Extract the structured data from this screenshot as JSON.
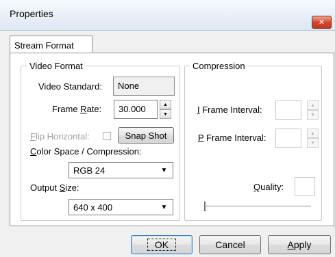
{
  "window": {
    "title": "Properties",
    "close_glyph": "✕"
  },
  "tabs": [
    {
      "label": "Stream Format",
      "selected": true
    }
  ],
  "video_format": {
    "group_label": "Video Format",
    "video_standard_label": "Video Standard:",
    "video_standard_value": "None",
    "frame_rate_label_prefix": "Frame ",
    "frame_rate_label_accel": "R",
    "frame_rate_label_suffix": "ate:",
    "frame_rate_value": "30.000",
    "flip_horizontal_accel": "F",
    "flip_horizontal_rest": "lip Horizontal:",
    "flip_horizontal_checked": false,
    "snap_shot_label": "Snap Shot",
    "color_space_accel": "C",
    "color_space_rest": "olor Space / Compression:",
    "color_space_value": "RGB 24",
    "output_size_prefix": "Output ",
    "output_size_accel": "S",
    "output_size_suffix": "ize:",
    "output_size_value": "640 x 400"
  },
  "compression": {
    "group_label": "Compression",
    "i_frame_accel": "I",
    "i_frame_rest": " Frame Interval:",
    "i_frame_value": "",
    "p_frame_accel": "P",
    "p_frame_rest": " Frame Interval:",
    "p_frame_value": "",
    "quality_accel": "Q",
    "quality_rest": "uality:",
    "quality_value": "",
    "quality_slider_level": 0.0
  },
  "buttons": {
    "ok": "OK",
    "cancel": "Cancel",
    "apply_accel": "A",
    "apply_rest": "pply"
  },
  "icons": {
    "spin_up": "▲",
    "spin_down": "▼",
    "combo_arrow": "▼"
  },
  "colors": {
    "close_button": "#d2432c",
    "default_button_border": "#3c7fb1",
    "disabled_text": "#a0a0a0"
  }
}
